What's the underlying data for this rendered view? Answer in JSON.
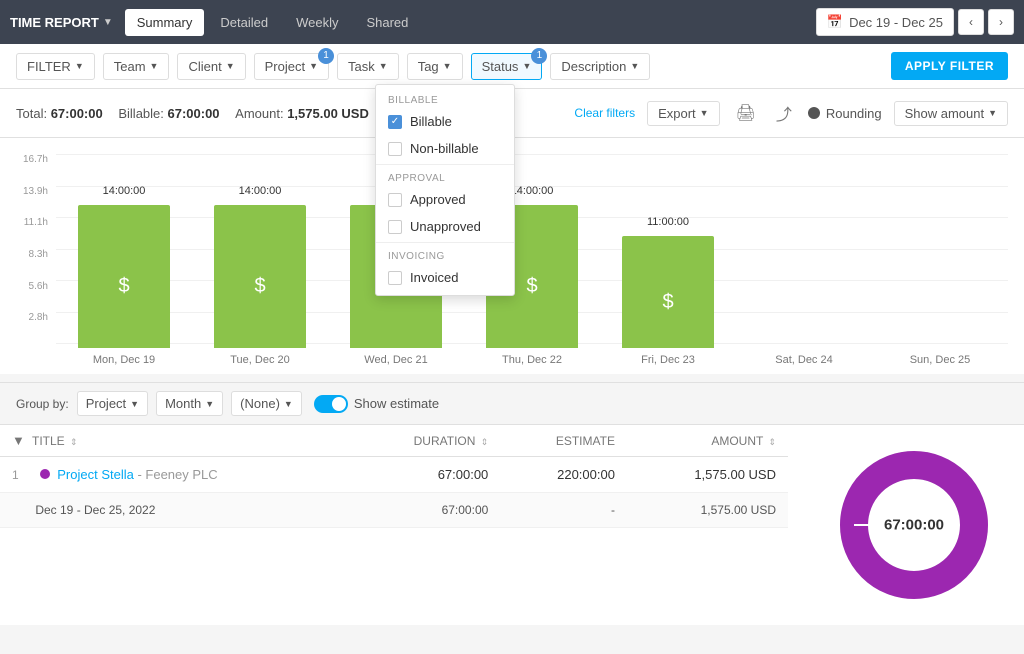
{
  "app": {
    "title": "TIME REPORT",
    "dropdown_arrow": "▼"
  },
  "nav": {
    "tabs": [
      {
        "label": "Summary",
        "active": true
      },
      {
        "label": "Detailed",
        "active": false
      },
      {
        "label": "Weekly",
        "active": false
      },
      {
        "label": "Shared",
        "active": false
      }
    ],
    "date_range": "Dec 19 - Dec 25",
    "calendar_icon": "📅",
    "prev_arrow": "‹",
    "next_arrow": "›"
  },
  "filter_bar": {
    "filters": [
      {
        "label": "FILTER",
        "has_badge": false
      },
      {
        "label": "Team",
        "has_badge": false
      },
      {
        "label": "Client",
        "has_badge": false
      },
      {
        "label": "Project",
        "has_badge": true,
        "badge_count": "1"
      },
      {
        "label": "Task",
        "has_badge": false
      },
      {
        "label": "Tag",
        "has_badge": false
      },
      {
        "label": "Status",
        "has_badge": true,
        "badge_count": "1"
      },
      {
        "label": "Description",
        "has_badge": false
      }
    ],
    "apply_button": "APPLY FILTER"
  },
  "summary": {
    "total_label": "Total:",
    "total_value": "67:00:00",
    "billable_label": "Billable:",
    "billable_value": "67:00:00",
    "amount_label": "Amount:",
    "amount_value": "1,575.00 USD",
    "clear_filters": "Clear filters",
    "export_label": "Export",
    "rounding_label": "Rounding",
    "show_amount_label": "Show amount"
  },
  "status_dropdown": {
    "sections": [
      {
        "label": "BILLABLE",
        "items": [
          {
            "label": "Billable",
            "checked": true
          },
          {
            "label": "Non-billable",
            "checked": false
          }
        ]
      },
      {
        "label": "APPROVAL",
        "items": [
          {
            "label": "Approved",
            "checked": false
          },
          {
            "label": "Unapproved",
            "checked": false
          }
        ]
      },
      {
        "label": "INVOICING",
        "items": [
          {
            "label": "Invoiced",
            "checked": false
          }
        ]
      }
    ]
  },
  "chart": {
    "y_labels": [
      "16.7h",
      "13.9h",
      "11.1h",
      "8.3h",
      "5.6h",
      "2.8h",
      ""
    ],
    "bars": [
      {
        "day": "Mon, Dec 19",
        "value": "14:00:00",
        "height_pct": 84
      },
      {
        "day": "Tue, Dec 20",
        "value": "14:00:00",
        "height_pct": 84
      },
      {
        "day": "Wed, Dec 21",
        "value": "14:00:00",
        "height_pct": 84
      },
      {
        "day": "Thu, Dec 22",
        "value": "14:00:00",
        "height_pct": 84
      },
      {
        "day": "Fri, Dec 23",
        "value": "11:00:00",
        "height_pct": 66
      },
      {
        "day": "Sat, Dec 24",
        "value": "",
        "height_pct": 0
      },
      {
        "day": "Sun, Dec 25",
        "value": "",
        "height_pct": 0
      }
    ],
    "dollar_icon": "$"
  },
  "group_bar": {
    "group_by_label": "Group by:",
    "group_options": [
      "Project",
      "Month",
      "(None)"
    ],
    "show_estimate_label": "Show estimate"
  },
  "table": {
    "columns": [
      {
        "label": "TITLE",
        "sort": true
      },
      {
        "label": "DURATION",
        "sort": true
      },
      {
        "label": "ESTIMATE",
        "sort": false
      },
      {
        "label": "AMOUNT",
        "sort": true
      }
    ],
    "rows": [
      {
        "type": "project",
        "num": "1",
        "project": "Project Stella",
        "client": "- Feeney PLC",
        "duration": "67:00:00",
        "estimate": "220:00:00",
        "amount": "1,575.00 USD"
      }
    ],
    "date_row": {
      "label": "Dec 19 - Dec 25, 2022",
      "duration": "67:00:00",
      "estimate": "-",
      "amount": "1,575.00 USD"
    }
  },
  "donut": {
    "center_value": "67:00:00",
    "color": "#9c27b0",
    "bg_color": "#e0e0e0"
  }
}
